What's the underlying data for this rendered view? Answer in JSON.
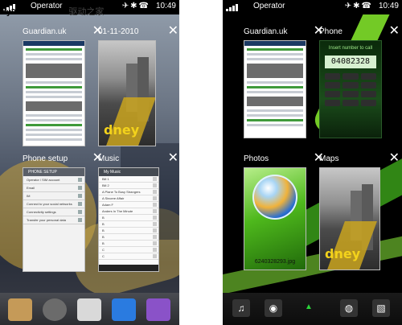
{
  "watermark": {
    "site": "MyDrivers.com",
    "cn": "驱动之家"
  },
  "phones": [
    {
      "status": {
        "operator": "Operator",
        "time": "10:49"
      },
      "cards": [
        {
          "title": "Guardian.uk",
          "type": "guardian"
        },
        {
          "title": "01-11-2010",
          "type": "street",
          "sign": "dney"
        },
        {
          "title": "Phone setup",
          "type": "settings",
          "header": "PHONE SETUP",
          "rows": [
            "Operator / SIM account",
            "Email",
            "IM",
            "Connect to your social networks",
            "Connectivity settings",
            "Transfer your personal data"
          ]
        },
        {
          "title": "Music",
          "type": "music",
          "header": "My Music",
          "rows": [
            "Bill 1",
            "Bill 2",
            "A Plane To Busy Strangers",
            "A Sincere Affair",
            "Adam F",
            "Anders In The Minute",
            "B",
            "B",
            "B",
            "B",
            "B",
            "C",
            "C"
          ]
        }
      ],
      "dock": [
        "envelope-icon",
        "settings-icon",
        "arrow-up-icon",
        "phone-icon",
        "map-icon"
      ]
    },
    {
      "status": {
        "operator": "Operator",
        "time": "10:49"
      },
      "cards": [
        {
          "title": "Guardian.uk",
          "type": "guardian"
        },
        {
          "title": "Phone",
          "type": "dial",
          "hint": "Insert number to call",
          "number": "04082328"
        },
        {
          "title": "Photos",
          "type": "photos",
          "filename": "6240328293.jpg"
        },
        {
          "title": "Maps",
          "type": "street",
          "sign": "dney"
        }
      ],
      "dock": [
        "music-icon",
        "camera-icon",
        "triangle-icon",
        "globe-icon",
        "gallery-icon"
      ]
    }
  ],
  "colors": {
    "accent": "#2ad43a",
    "status_bg": "#000000"
  }
}
